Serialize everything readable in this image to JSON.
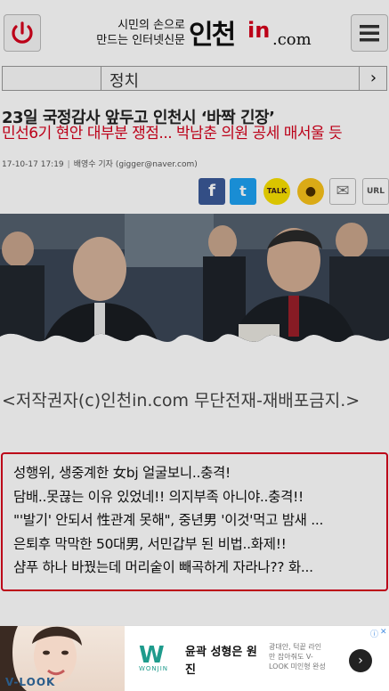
{
  "header": {
    "tagline_1": "시민의 손으로",
    "tagline_2": "만드는 인터넷신문",
    "logo_korean": "인천",
    "logo_in": "in",
    "logo_com": ".com",
    "power_icon": "power-icon",
    "menu_icon": "hamburger-menu-icon"
  },
  "section": {
    "label": "정치",
    "next_glyph": "›"
  },
  "article": {
    "headline": "23일 국정감사 앞두고 인천시 ‘바짝 긴장’",
    "subhead": "민선6기 현안 대부분 쟁점... 박남춘 의원 공세 매서울 듯",
    "date": "17-10-17 17:19",
    "author": "배영수 기자 (gigger@naver.com)",
    "caption": "<저작권자(c)인천in.com 무단전재-재배포금지.>"
  },
  "share": {
    "facebook": "f",
    "twitter": "t",
    "kakaotalk": "TALK",
    "kakaostory": "●",
    "mail": "✉",
    "url": "URL"
  },
  "ad_box": {
    "lines": [
      "성행위, 생중계한 女bj 얼굴보니..충격!",
      "담배..못끊는 이유 있었네!! 의지부족 아니야..충격!!",
      "\"'발기' 안되서 性관계 못해\", 중년男 '이것'먹고 밤새 ...",
      "은퇴후 막막한 50대男, 서민갑부 된 비법..화제!!",
      "샴푸 하나 바꿨는데 머리숱이 빼곡하게 자라나?? 화..."
    ]
  },
  "bottom_ad": {
    "brand_mark": "W",
    "brand_name": "WONJIN",
    "title": "윤곽 성형은 원진",
    "description": "광대안, 턱끝 라인만 잡아줘도 V-LOOK 미인형 완성",
    "model_text": "V-LOOK",
    "arrow": "›",
    "info": "ⓘ",
    "close": "✕"
  },
  "colors": {
    "brand_red": "#d6001c",
    "facebook": "#3b5998",
    "twitter": "#1da1f2",
    "kakao": "#f9e000"
  }
}
